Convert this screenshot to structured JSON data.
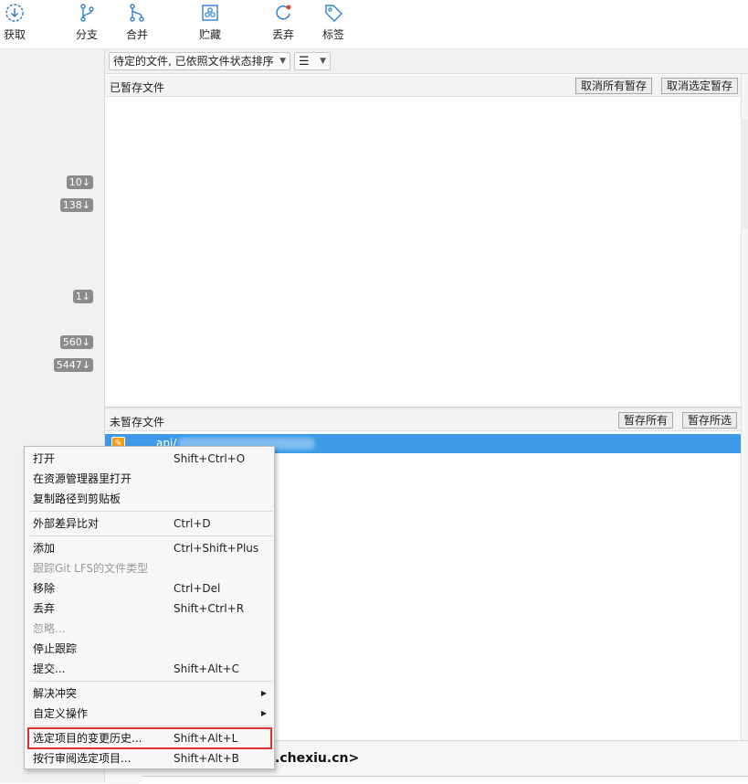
{
  "toolbar": {
    "fetch": "获取",
    "branch": "分支",
    "merge": "合并",
    "stash": "贮藏",
    "discard": "丢弃",
    "tag": "标签"
  },
  "sidebar": {
    "badges": [
      "10↓",
      "138↓",
      "1↓",
      "560↓",
      "5447↓"
    ]
  },
  "filter": {
    "sort_label": "待定的文件, 已依照文件状态排序",
    "view_icon": "list-icon"
  },
  "staged": {
    "title": "已暂存文件",
    "unstage_all": "取消所有暂存",
    "unstage_selected": "取消选定暂存"
  },
  "unstaged": {
    "title": "未暂存文件",
    "stage_all": "暂存所有",
    "stage_selected": "暂存所选",
    "selected_file_prefix": "api/"
  },
  "commit": {
    "author_email_suffix": ".chexiu.cn>"
  },
  "context_menu": {
    "items": [
      {
        "label": "打开",
        "shortcut": "Shift+Ctrl+O"
      },
      {
        "label": "在资源管理器里打开",
        "shortcut": ""
      },
      {
        "label": "复制路径到剪贴板",
        "shortcut": ""
      },
      {
        "label": "外部差异比对",
        "shortcut": "Ctrl+D"
      },
      {
        "label": "添加",
        "shortcut": "Ctrl+Shift+Plus"
      },
      {
        "label": "跟踪Git LFS的文件类型",
        "shortcut": ""
      },
      {
        "label": "移除",
        "shortcut": "Ctrl+Del"
      },
      {
        "label": "丢弃",
        "shortcut": "Shift+Ctrl+R"
      },
      {
        "label": "忽略...",
        "shortcut": ""
      },
      {
        "label": "停止跟踪",
        "shortcut": ""
      },
      {
        "label": "提交...",
        "shortcut": "Shift+Alt+C"
      },
      {
        "label": "解决冲突",
        "shortcut": ""
      },
      {
        "label": "自定义操作",
        "shortcut": ""
      },
      {
        "label": "选定项目的变更历史...",
        "shortcut": "Shift+Alt+L"
      },
      {
        "label": "按行审阅选定项目...",
        "shortcut": "Shift+Alt+B"
      }
    ]
  },
  "colors": {
    "selection": "#3d9be9",
    "highlight_border": "#e03030",
    "file_modified": "#f39c12"
  }
}
